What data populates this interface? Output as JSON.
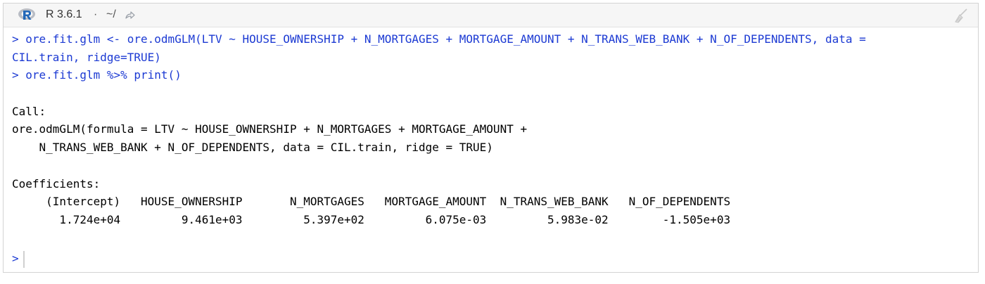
{
  "header": {
    "title": "R 3.6.1",
    "separator": "·",
    "working_dir": "~/",
    "icons": {
      "logo": "r-logo-icon",
      "goto": "goto-directory-icon",
      "clear": "broom-icon"
    }
  },
  "console": {
    "lines": [
      {
        "type": "cmd",
        "text": "> ore.fit.glm <- ore.odmGLM(LTV ~ HOUSE_OWNERSHIP + N_MORTGAGES + MORTGAGE_AMOUNT + N_TRANS_WEB_BANK + N_OF_DEPENDENTS, data ="
      },
      {
        "type": "cmd",
        "text": "CIL.train, ridge=TRUE)"
      },
      {
        "type": "cmd",
        "text": "> ore.fit.glm %>% print()"
      },
      {
        "type": "out",
        "text": ""
      },
      {
        "type": "out",
        "text": "Call:"
      },
      {
        "type": "out",
        "text": "ore.odmGLM(formula = LTV ~ HOUSE_OWNERSHIP + N_MORTGAGES + MORTGAGE_AMOUNT +"
      },
      {
        "type": "out",
        "text": "    N_TRANS_WEB_BANK + N_OF_DEPENDENTS, data = CIL.train, ridge = TRUE)"
      },
      {
        "type": "out",
        "text": ""
      },
      {
        "type": "out",
        "text": "Coefficients:"
      },
      {
        "type": "out",
        "text": "     (Intercept)   HOUSE_OWNERSHIP       N_MORTGAGES   MORTGAGE_AMOUNT  N_TRANS_WEB_BANK   N_OF_DEPENDENTS"
      },
      {
        "type": "out",
        "text": "       1.724e+04         9.461e+03         5.397e+02         6.075e-03         5.983e-02        -1.505e+03"
      },
      {
        "type": "out",
        "text": ""
      }
    ],
    "prompt": ">"
  }
}
